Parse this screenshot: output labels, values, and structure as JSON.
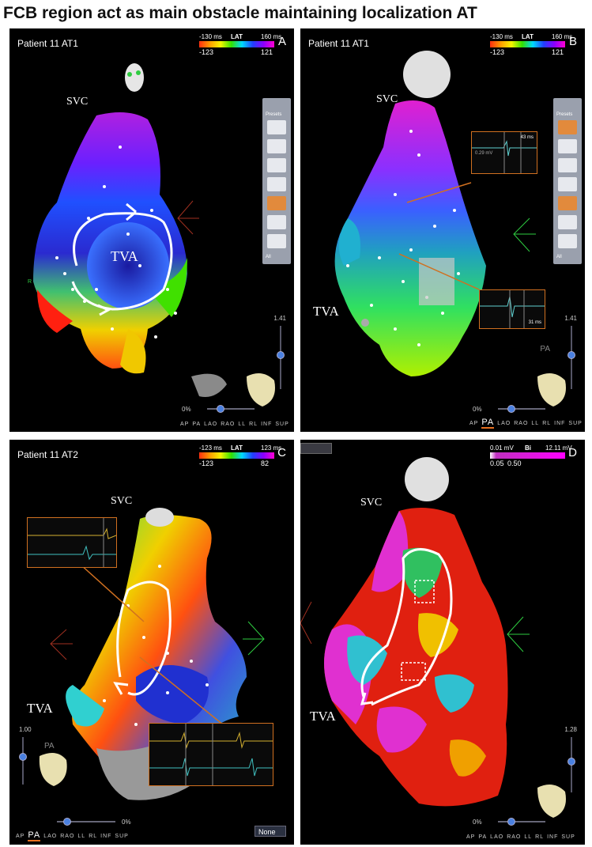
{
  "title": "FCB region act as main obstacle maintaining localization AT",
  "panels": {
    "A": {
      "letter": "A",
      "patient": "Patient 11 AT1",
      "lat": {
        "top_left": "-130 ms",
        "label": "LAT",
        "top_right": "160 ms",
        "bottom_left": "-123",
        "bottom_right": "121"
      },
      "labels": {
        "svc": "SVC",
        "tva": "TVA"
      },
      "zoom": "1.41",
      "opacity": "0%",
      "views": [
        "AP",
        "PA",
        "LAO",
        "RAO",
        "LL",
        "RL",
        "INF",
        "SUP"
      ],
      "active_view": "",
      "toolbar": {
        "preset": "Presets",
        "all": "All"
      }
    },
    "B": {
      "letter": "B",
      "patient": "Patient 11 AT1",
      "lat": {
        "top_left": "-130 ms",
        "label": "LAT",
        "top_right": "160 ms",
        "bottom_left": "-123",
        "bottom_right": "121"
      },
      "labels": {
        "svc": "SVC",
        "tva": "TVA"
      },
      "egm_top": {
        "v1": "43 ms",
        "v2": "0.29 mV"
      },
      "egm_bottom": {
        "v1": "31 ms"
      },
      "zoom": "1.41",
      "opacity": "0%",
      "views": [
        "AP",
        "PA",
        "LAO",
        "RAO",
        "LL",
        "RL",
        "INF",
        "SUP"
      ],
      "active_view": "PA",
      "orientation": "PA",
      "toolbar": {
        "preset": "Presets",
        "all": "All"
      }
    },
    "C": {
      "letter": "C",
      "patient": "Patient 11 AT2",
      "lat": {
        "top_left": "-123 ms",
        "label": "LAT",
        "top_right": "123 ms",
        "bottom_left": "-123",
        "bottom_right": "82"
      },
      "labels": {
        "svc": "SVC",
        "tva": "TVA"
      },
      "zoom": "1.00",
      "opacity": "0%",
      "views": [
        "AP",
        "PA",
        "LAO",
        "RAO",
        "LL",
        "RL",
        "INF",
        "SUP"
      ],
      "active_view": "PA",
      "orientation": "PA",
      "dropdown": "None"
    },
    "D": {
      "letter": "D",
      "bi": {
        "top_left": "0.01 mV",
        "label": "Bi",
        "top_right": "12.11 mV",
        "bottom_left": "0.05",
        "bottom_mid": "0.50"
      },
      "labels": {
        "svc": "SVC",
        "tva": "TVA"
      },
      "zoom": "1.28",
      "opacity": "0%",
      "views": [
        "AP",
        "PA",
        "LAO",
        "RAO",
        "LL",
        "RL",
        "INF",
        "SUP"
      ],
      "active_view": ""
    }
  },
  "colors": {
    "lat_scale": [
      "#ff3010",
      "#ff9d00",
      "#f5f500",
      "#32e000",
      "#00d8ff",
      "#2040ff",
      "#8a00ff",
      "#ff00d0"
    ],
    "bi_scale": [
      "#ffffff",
      "#c030c0",
      "#ff00ff"
    ],
    "egm_border": "#d07020"
  }
}
